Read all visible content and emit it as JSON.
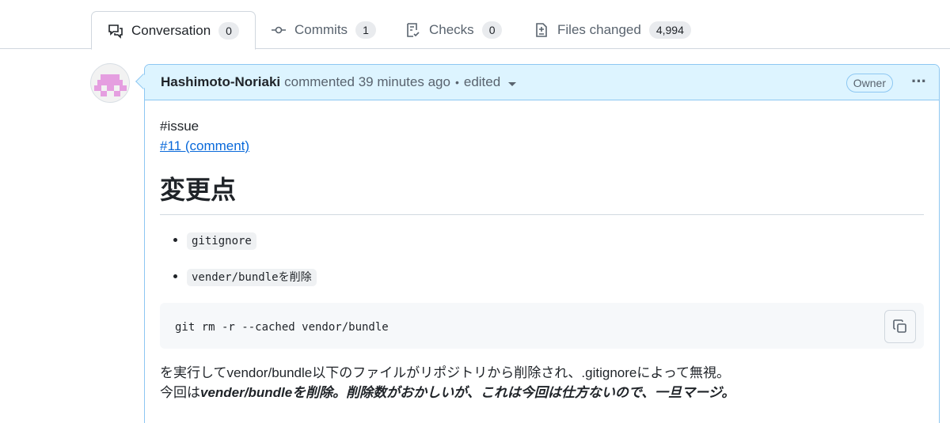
{
  "tabs": [
    {
      "label": "Conversation",
      "count": "0",
      "icon": "conversation-icon",
      "active": true
    },
    {
      "label": "Commits",
      "count": "1",
      "icon": "commit-icon",
      "active": false
    },
    {
      "label": "Checks",
      "count": "0",
      "icon": "checklist-icon",
      "active": false
    },
    {
      "label": "Files changed",
      "count": "4,994",
      "icon": "file-diff-icon",
      "active": false
    }
  ],
  "comment": {
    "author": "Hashimoto-Noriaki",
    "action": "commented",
    "time": "39 minutes ago",
    "separator": "•",
    "edited": "edited",
    "badge": "Owner",
    "menu": "···",
    "body": {
      "tag_line": "#issue",
      "link": "#11 (comment)",
      "heading": "変更点",
      "list": [
        "gitignore",
        "vender/bundleを削除"
      ],
      "code": "git rm -r --cached vendor/bundle",
      "paragraph_line1": "を実行してvendor/bundle以下のファイルがリポジトリから削除され、.gitignoreによって無視。",
      "paragraph_line2_prefix": "今回は",
      "paragraph_line2_emphasis": "vender/bundleを削除。削除数がおかしいが、これは今回は仕方ないので、一旦マージ。"
    }
  },
  "colors": {
    "header_bg": "#ddf4ff",
    "header_border": "#8dc7f2",
    "link": "#0969da",
    "avatar": "#e59ee0"
  }
}
